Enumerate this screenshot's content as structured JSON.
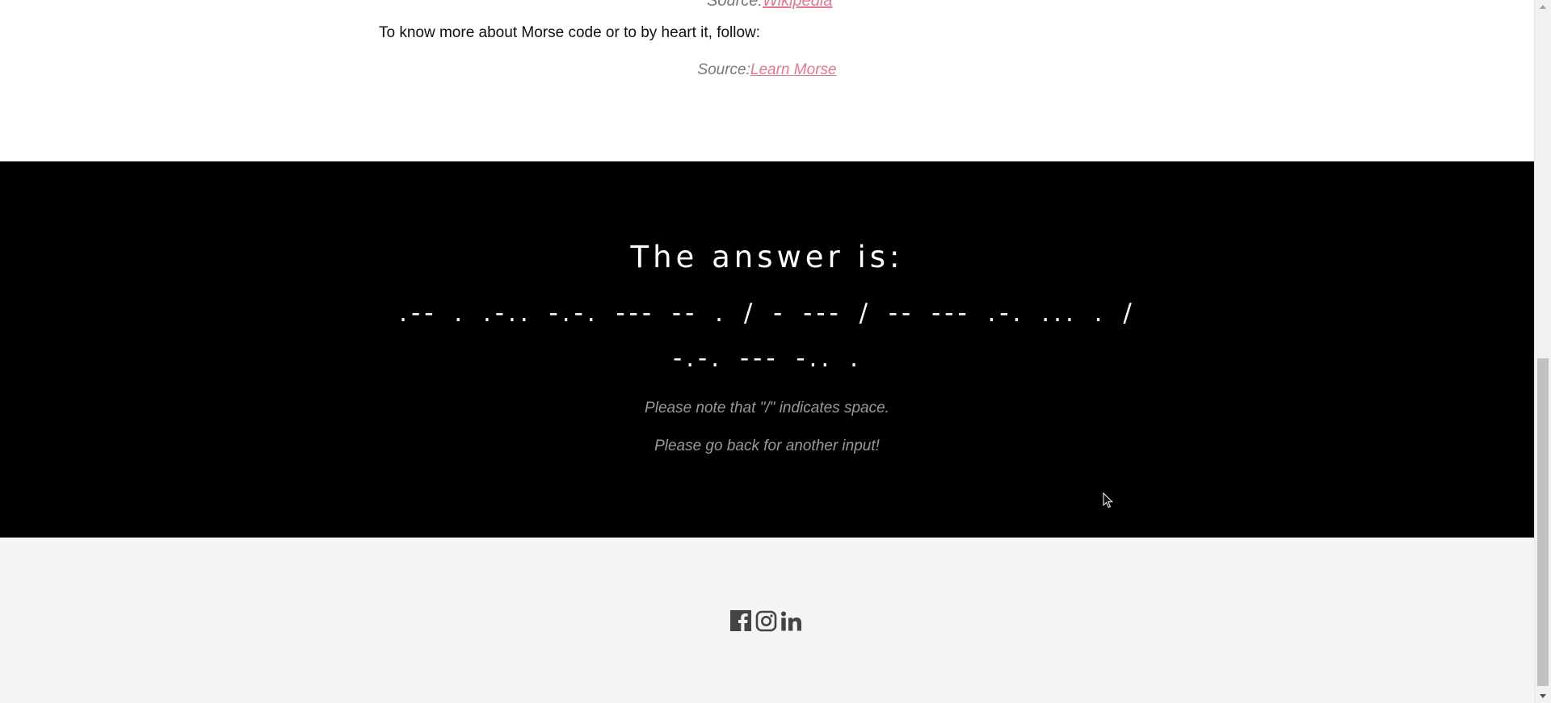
{
  "top": {
    "cut_source_prefix": "Source:",
    "cut_source_link": "Wikipedia",
    "intro": "To know more about Morse code or to by heart it, follow:",
    "source_prefix": "Source:",
    "source_link": "Learn Morse"
  },
  "answer": {
    "title": "The answer is:",
    "morse_line1": ".-- . .-.. -.-. --- -- . / - --- / -- --- .-. ... . /",
    "morse_line2": "-.-. --- -.. .",
    "note_space": "Please note that \"/\" indicates space.",
    "note_back": "Please go back for another input!"
  },
  "footer": {
    "social": [
      {
        "name": "facebook"
      },
      {
        "name": "instagram"
      },
      {
        "name": "linkedin"
      }
    ]
  },
  "colors": {
    "link": "#e07a8c",
    "answer_bg": "#000000",
    "footer_bg": "#f5f5f5",
    "muted": "#9a9a9a",
    "icon": "#444444"
  }
}
